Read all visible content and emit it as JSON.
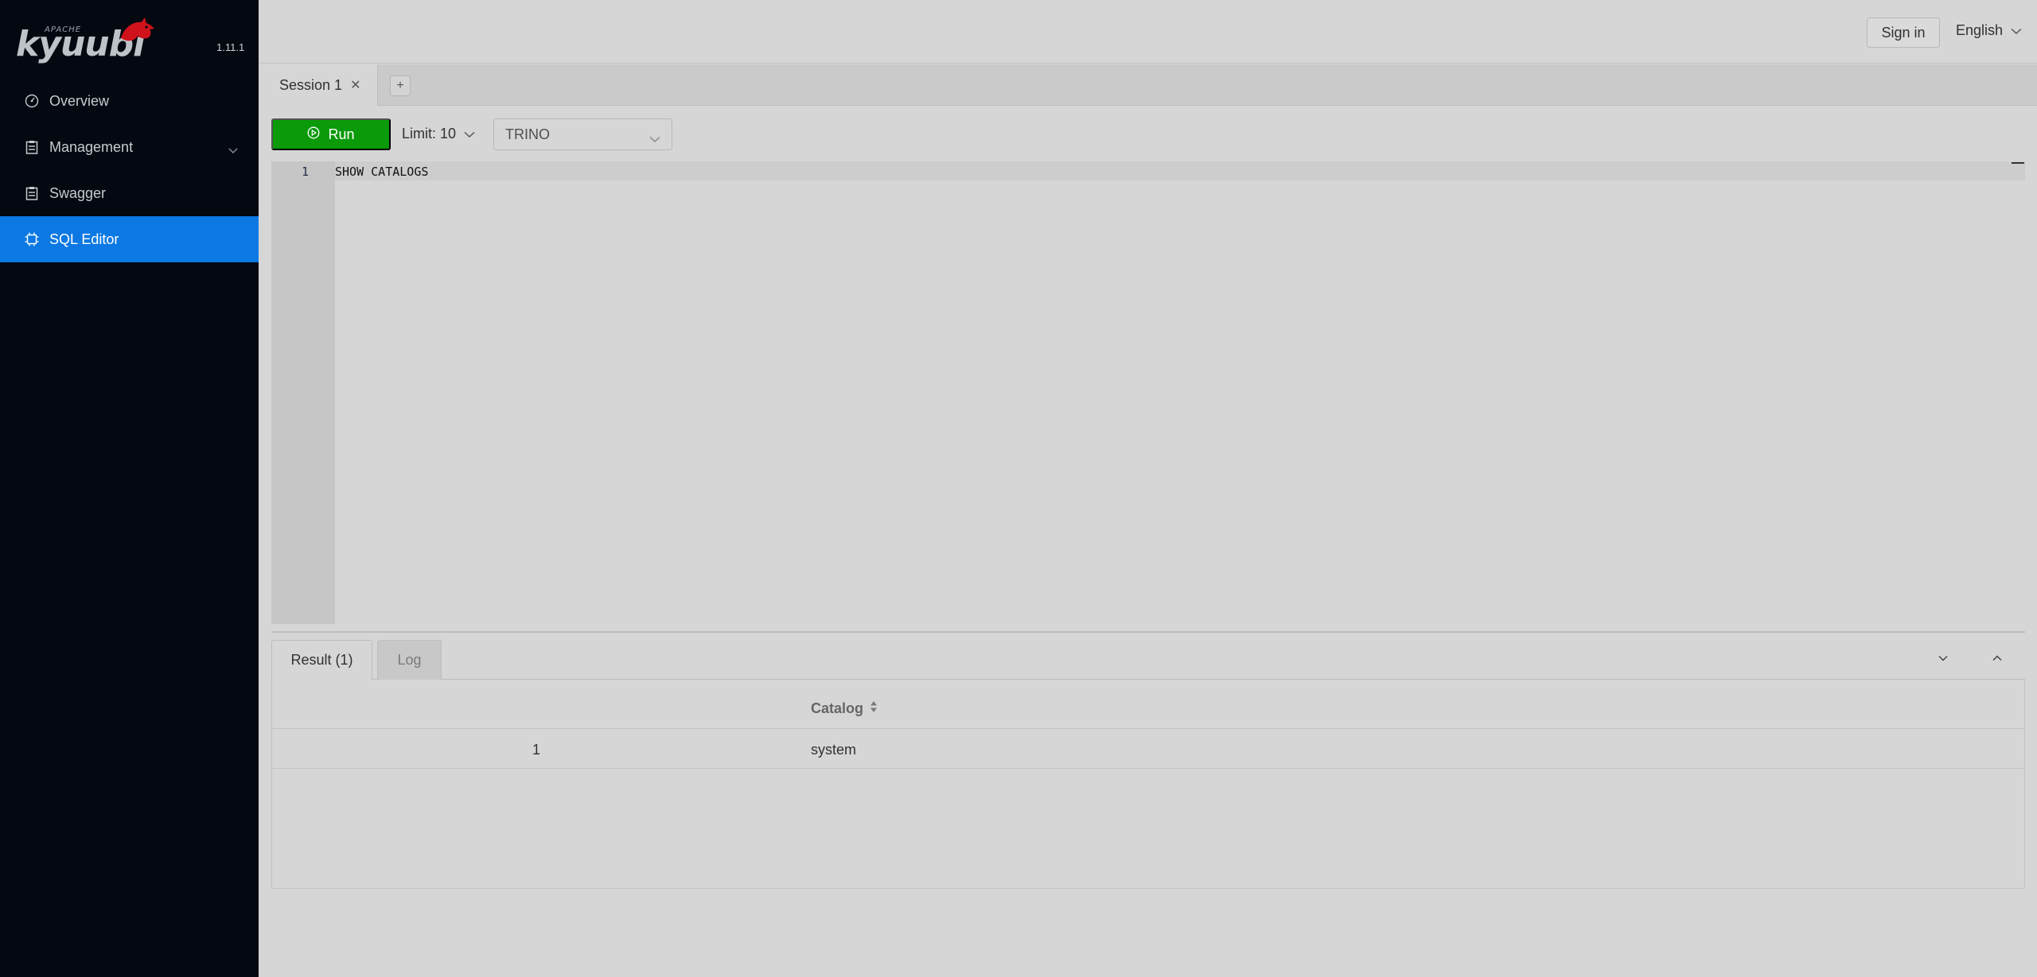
{
  "brand": {
    "apache": "APACHE",
    "name": "kyuubi",
    "version": "1.11.1"
  },
  "sidebar": {
    "items": [
      {
        "label": "Overview",
        "icon": "dashboard-icon"
      },
      {
        "label": "Management",
        "icon": "clipboard-icon"
      },
      {
        "label": "Swagger",
        "icon": "clipboard-icon"
      },
      {
        "label": "SQL Editor",
        "icon": "chip-icon",
        "active": true
      }
    ]
  },
  "header": {
    "signin_label": "Sign in",
    "language": "English"
  },
  "session_tabs": {
    "tabs": [
      {
        "label": "Session 1"
      }
    ],
    "add_label": "+"
  },
  "toolbar": {
    "run_label": "Run",
    "limit_label": "Limit: 10",
    "engine_value": "TRINO"
  },
  "editor": {
    "lines": [
      {
        "number": "1",
        "code": "SHOW CATALOGS"
      }
    ]
  },
  "results": {
    "tabs": [
      {
        "label": "Result (1)",
        "active": true
      },
      {
        "label": "Log",
        "active": false
      }
    ],
    "columns": [
      "Catalog"
    ],
    "rows": [
      {
        "index": "1",
        "values": [
          "system"
        ]
      }
    ]
  },
  "colors": {
    "sidebar_bg": "#040810",
    "active_nav": "#0b78e3",
    "run_button": "#0a9a0a",
    "logo_bird": "#d0121b"
  }
}
